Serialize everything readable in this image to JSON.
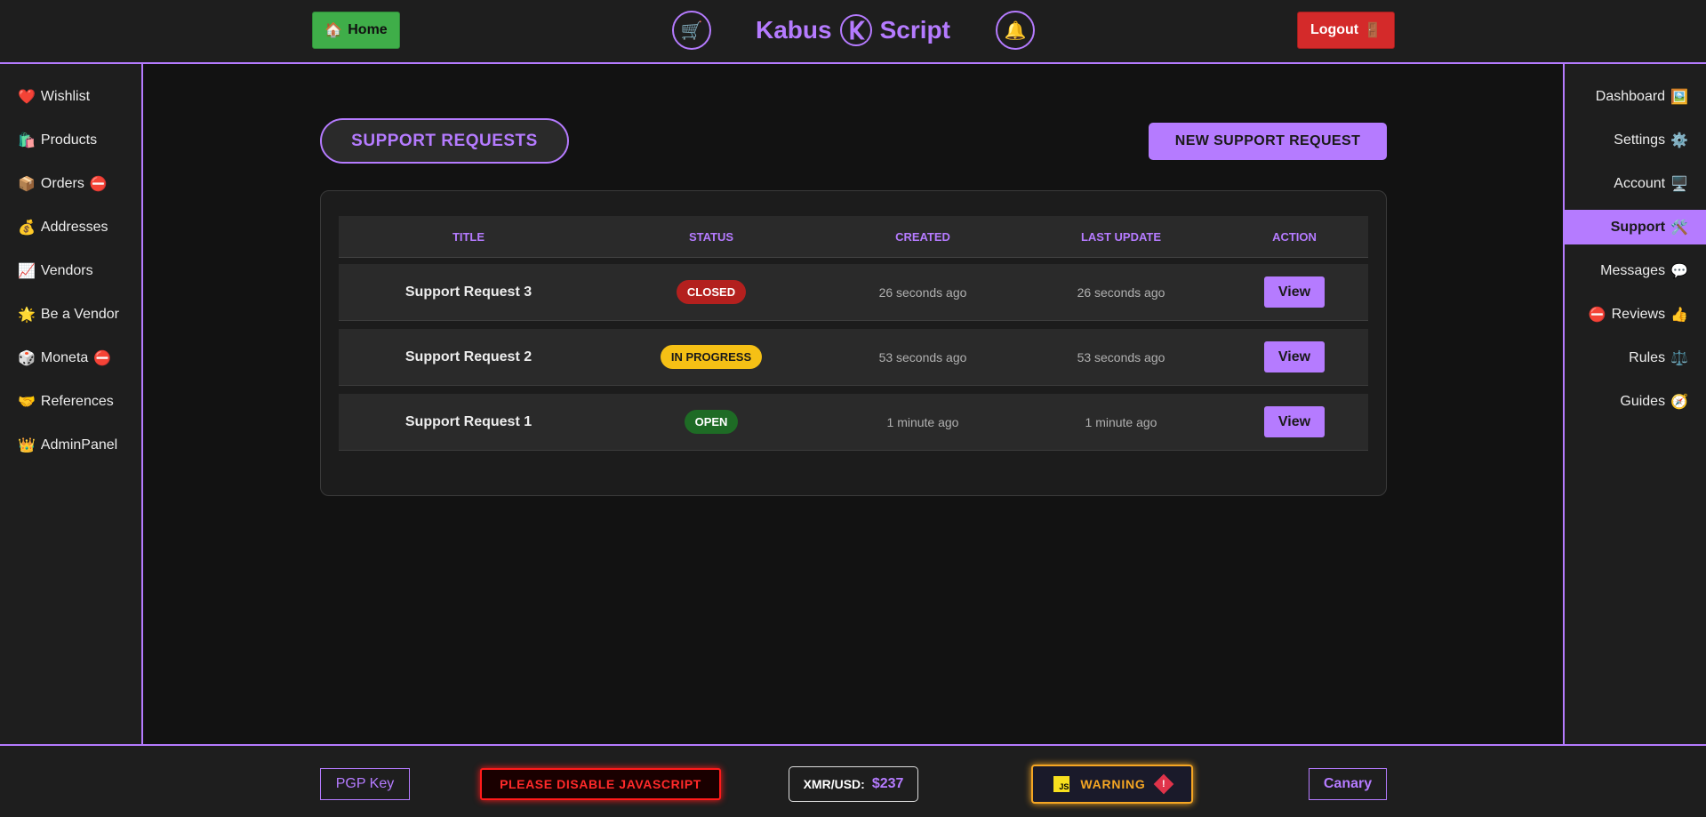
{
  "header": {
    "home": {
      "icon": "🏠",
      "label": "Home"
    },
    "cart_icon": "🛒",
    "bell_icon": "🔔",
    "brand": {
      "left": "Kabus",
      "right": "Script"
    },
    "logout": {
      "label": "Logout",
      "icon": "🚪"
    }
  },
  "left_sidebar": {
    "items": [
      {
        "icon": "❤️",
        "label": "Wishlist",
        "badge": ""
      },
      {
        "icon": "🛍️",
        "label": "Products",
        "badge": ""
      },
      {
        "icon": "📦",
        "label": "Orders",
        "badge": "⛔"
      },
      {
        "icon": "💰",
        "label": "Addresses",
        "badge": ""
      },
      {
        "icon": "📈",
        "label": "Vendors",
        "badge": ""
      },
      {
        "icon": "🌟",
        "label": "Be a Vendor",
        "badge": ""
      },
      {
        "icon": "🎲",
        "label": "Moneta",
        "badge": "⛔"
      },
      {
        "icon": "🤝",
        "label": "References",
        "badge": ""
      },
      {
        "icon": "👑",
        "label": "AdminPanel",
        "badge": ""
      }
    ]
  },
  "right_sidebar": {
    "items": [
      {
        "pre": "",
        "label": "Dashboard",
        "icon": "🖼️",
        "active": false
      },
      {
        "pre": "",
        "label": "Settings",
        "icon": "⚙️",
        "active": false
      },
      {
        "pre": "",
        "label": "Account",
        "icon": "🖥️",
        "active": false
      },
      {
        "pre": "",
        "label": "Support",
        "icon": "🛠️",
        "active": true
      },
      {
        "pre": "",
        "label": "Messages",
        "icon": "💬",
        "active": false
      },
      {
        "pre": "⛔",
        "label": "Reviews",
        "icon": "👍",
        "active": false
      },
      {
        "pre": "",
        "label": "Rules",
        "icon": "⚖️",
        "active": false
      },
      {
        "pre": "",
        "label": "Guides",
        "icon": "🧭",
        "active": false
      }
    ]
  },
  "main": {
    "title": "SUPPORT REQUESTS",
    "new_button": "NEW SUPPORT REQUEST",
    "table": {
      "headers": [
        "TITLE",
        "STATUS",
        "CREATED",
        "LAST UPDATE",
        "ACTION"
      ],
      "rows": [
        {
          "title": "Support Request 3",
          "status": "CLOSED",
          "status_bg": "#b3201e",
          "status_fg": "#ffffff",
          "created": "26 seconds ago",
          "updated": "26 seconds ago",
          "action": "View"
        },
        {
          "title": "Support Request 2",
          "status": "IN PROGRESS",
          "status_bg": "#f5c015",
          "status_fg": "#1a1a1a",
          "created": "53 seconds ago",
          "updated": "53 seconds ago",
          "action": "View"
        },
        {
          "title": "Support Request 1",
          "status": "OPEN",
          "status_bg": "#1e6b25",
          "status_fg": "#ffffff",
          "created": "1 minute ago",
          "updated": "1 minute ago",
          "action": "View"
        }
      ]
    }
  },
  "footer": {
    "pgp": "PGP Key",
    "js_alert": "PLEASE DISABLE JAVASCRIPT",
    "xmr_label": "XMR/USD:",
    "xmr_value": "$237",
    "js_icon_text": "JS",
    "warning": "WARNING",
    "warning_icon_text": "!",
    "canary": "Canary"
  },
  "colors": {
    "accent": "#b57bff",
    "background": "#121212",
    "panel": "#1e1e1e"
  }
}
